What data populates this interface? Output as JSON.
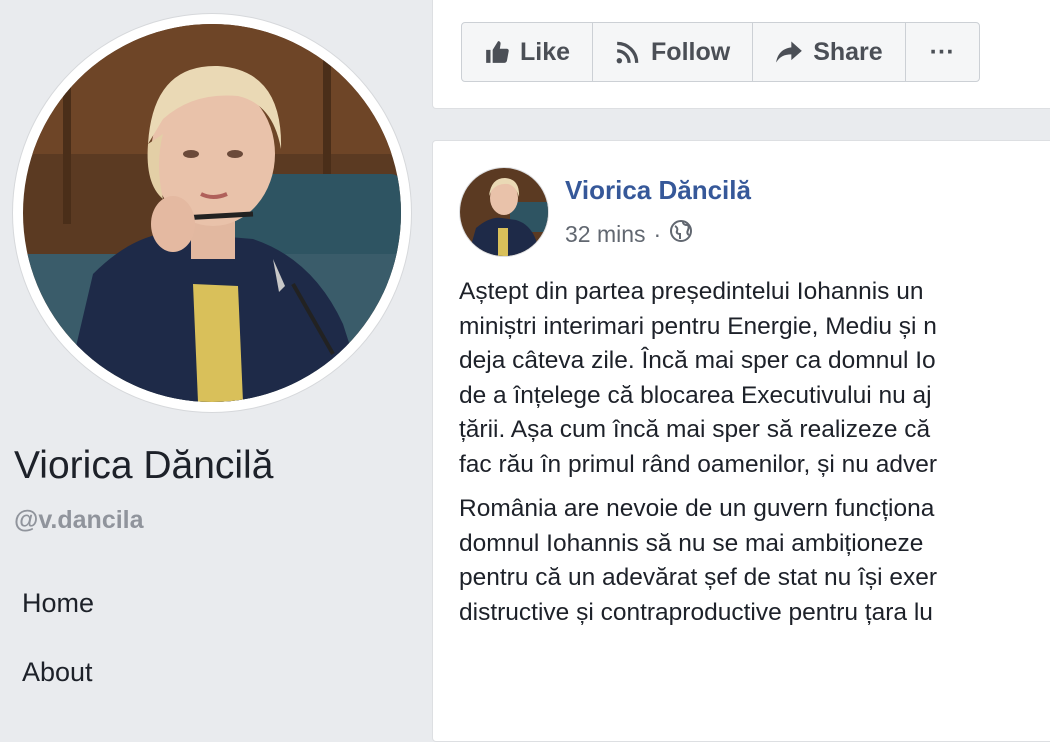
{
  "profile": {
    "name": "Viorica Dăncilă",
    "handle": "@v.dancila",
    "nav": [
      {
        "label": "Home"
      },
      {
        "label": "About"
      }
    ]
  },
  "actions": {
    "like": "Like",
    "follow": "Follow",
    "share": "Share",
    "more": "···"
  },
  "post": {
    "author": "Viorica Dăncilă",
    "time": "32 mins",
    "separator": "·",
    "paragraphs": [
      [
        "Aștept din partea președintelui Iohannis un",
        "miniștri interimari pentru Energie, Mediu și n",
        "deja câteva zile. Încă mai sper ca domnul Io",
        "de a înțelege că blocarea Executivului nu aj",
        "țării. Așa cum încă mai sper să realizeze că",
        "fac rău în primul rând oamenilor, și nu adver"
      ],
      [
        "România are nevoie de un guvern funcționa",
        "domnul Iohannis să nu se mai ambiționeze",
        "pentru că un adevărat șef de stat nu își exer",
        "distructive și contraproductive pentru țara lu"
      ]
    ]
  },
  "colors": {
    "background": "#e9ebee",
    "link": "#365899",
    "muted": "#90949c",
    "button_bg": "#f5f6f7"
  }
}
